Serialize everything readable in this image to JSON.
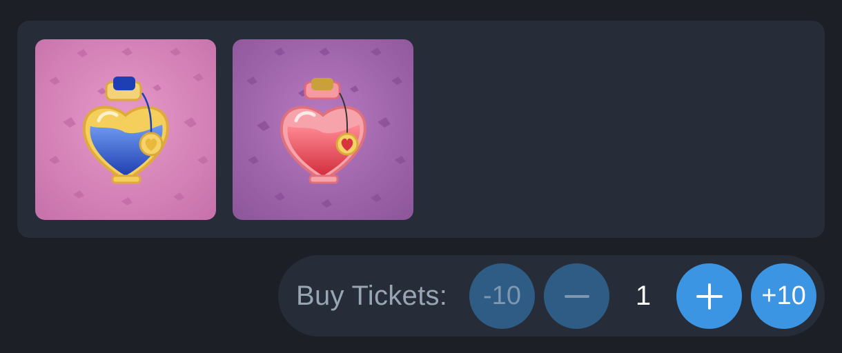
{
  "items": [
    {
      "name": "blue-heart-potion",
      "background_color": "#d884b8",
      "liquid_color": "#2e59c9",
      "cap_color": "#1e3fb4"
    },
    {
      "name": "red-heart-potion",
      "background_color": "#a066a8",
      "liquid_color": "#e3434f",
      "cap_color": "#c9a03a"
    }
  ],
  "tickets": {
    "label": "Buy Tickets:",
    "minus_ten_label": "-10",
    "minus_icon": "minus-icon",
    "quantity": "1",
    "plus_icon": "plus-icon",
    "plus_ten_label": "+10"
  },
  "colors": {
    "page_background": "#1c2026",
    "panel_background": "#262d38",
    "button_disabled": "#2f5c85",
    "button_active": "#3b95e3"
  }
}
